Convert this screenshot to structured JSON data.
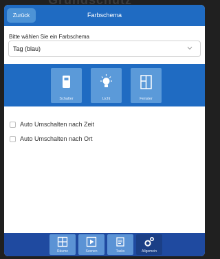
{
  "background_title": "Grundschutz",
  "header": {
    "back_label": "Zurück",
    "title": "Farbschema"
  },
  "scheme": {
    "prompt": "Bitte wählen Sie ein Farbschema",
    "selected": "Tag (blau)"
  },
  "tiles": [
    {
      "label": "Schalter",
      "icon": "switch-icon"
    },
    {
      "label": "Licht",
      "icon": "light-bulb-icon"
    },
    {
      "label": "Fenster",
      "icon": "window-icon"
    }
  ],
  "options": [
    {
      "label": "Auto Umschalten nach Zeit",
      "checked": false
    },
    {
      "label": "Auto Umschalten nach Ort",
      "checked": false
    }
  ],
  "nav": [
    {
      "label": "Räume",
      "icon": "rooms-icon",
      "active": false
    },
    {
      "label": "Szenen",
      "icon": "play-icon",
      "active": false
    },
    {
      "label": "Tasks",
      "icon": "tasks-icon",
      "active": false
    },
    {
      "label": "Allgemein",
      "icon": "gears-icon",
      "active": true
    }
  ],
  "colors": {
    "primary": "#1f6bc2",
    "tile": "#5b9ad9",
    "footer": "#1f4aa0",
    "active_nav": "#1b3f86"
  }
}
